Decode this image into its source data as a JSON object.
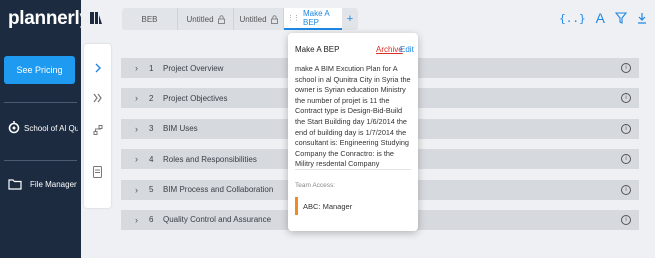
{
  "sidebar": {
    "logo": "plannerly",
    "pricing_button": "See Pricing",
    "project_name": "School of Al Qu...",
    "file_manager": "File Manager"
  },
  "tabs": [
    {
      "label": "BEB",
      "locked": false,
      "active": false
    },
    {
      "label": "Untitled",
      "locked": true,
      "active": false
    },
    {
      "label": "Untitled",
      "locked": true,
      "active": false
    },
    {
      "label": "Make A BEP",
      "locked": false,
      "active": true
    }
  ],
  "toolbar": {
    "add_tab": "+",
    "icons": [
      "code-braces-icon",
      "text-icon",
      "filter-icon",
      "download-icon"
    ]
  },
  "sections": [
    {
      "number": "1",
      "title": "Project Overview"
    },
    {
      "number": "2",
      "title": "Project Objectives"
    },
    {
      "number": "3",
      "title": "BIM Uses"
    },
    {
      "number": "4",
      "title": "Roles and Responsibilities"
    },
    {
      "number": "5",
      "title": "BIM Process and Collaboration"
    },
    {
      "number": "6",
      "title": "Quality Control and Assurance"
    }
  ],
  "popover": {
    "title": "Make A BEP",
    "archive": "Archive",
    "edit": "Edit",
    "description": "make A BIM Excution Plan for A school in al Qunitra City in Syria the owner is Syrian education Ministry the number of projet is 11 the Contract type is Design-Bid-Build the Start Building day 1/6/2014 the end of building day is 1/7/2014 the consultant is: Engineering Studying Company the Conractro: is the Militry resdental Company",
    "team_label": "Team Access:",
    "team_member": "ABC: Manager",
    "accent_color": "#f08a24"
  },
  "colors": {
    "sidebar_bg": "#1c2b40",
    "accent": "#1e88e5",
    "pricing": "#1e9bf0"
  }
}
